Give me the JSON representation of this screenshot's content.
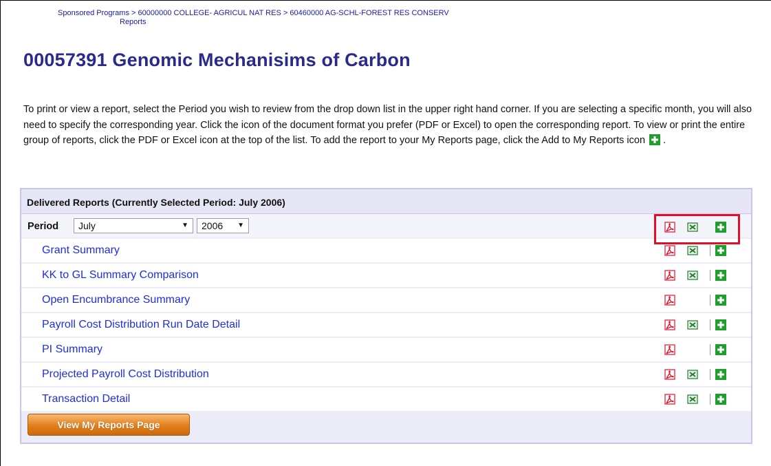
{
  "breadcrumb": {
    "items": [
      "Sponsored Programs",
      "60000000  COLLEGE- AGRICUL NAT RES",
      "60460000  AG-SCHL-FOREST RES CONSERV"
    ],
    "separator": ">",
    "current": "Reports"
  },
  "page": {
    "title": "00057391  Genomic Mechanisims of Carbon",
    "intro": "To print or view a report, select the Period you wish to review from the drop down list in the upper right hand corner. If you are selecting a specific month, you will also need to specify the corresponding year. Click the icon of the document format you prefer (PDF or Excel) to open the corresponding report. To view or print the entire group of reports, click the PDF or Excel icon at the top of the list. To add the report to your My Reports page, click the Add to My Reports icon",
    "intro_end": "."
  },
  "panel": {
    "header": "Delivered Reports (Currently Selected Period: July 2006)",
    "period_label": "Period",
    "month_selected": "July",
    "year_selected": "2006"
  },
  "reports": [
    {
      "name": "Grant Summary",
      "pdf": true,
      "excel": true,
      "add": true
    },
    {
      "name": "KK to GL Summary Comparison",
      "pdf": true,
      "excel": true,
      "add": true
    },
    {
      "name": "Open Encumbrance Summary",
      "pdf": true,
      "excel": false,
      "add": true
    },
    {
      "name": "Payroll Cost Distribution Run Date Detail",
      "pdf": true,
      "excel": true,
      "add": true
    },
    {
      "name": "PI Summary",
      "pdf": true,
      "excel": false,
      "add": true
    },
    {
      "name": "Projected Payroll Cost Distribution",
      "pdf": true,
      "excel": true,
      "add": true
    },
    {
      "name": "Transaction Detail",
      "pdf": true,
      "excel": true,
      "add": true
    }
  ],
  "button": {
    "view_my_reports": "View My Reports Page"
  },
  "icons": {
    "pdf": "pdf-icon",
    "excel": "excel-icon",
    "add": "add-to-my-reports-icon"
  },
  "colors": {
    "link": "#1e2ee0",
    "title": "#2a2a8c",
    "highlight": "#e0102a",
    "button": "#e27f1a",
    "add_green": "#1e9e2a",
    "pdf_red": "#e0102a",
    "excel_green": "#1f7a2a"
  }
}
